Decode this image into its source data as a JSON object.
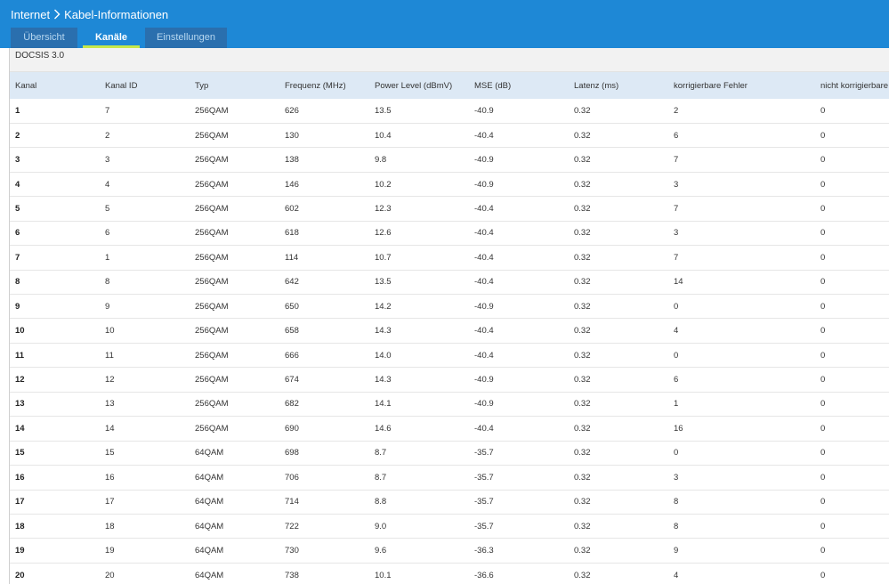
{
  "breadcrumb": {
    "parent": "Internet",
    "current": "Kabel-Informationen"
  },
  "tabs": [
    {
      "label": "Übersicht",
      "active": false
    },
    {
      "label": "Kanäle",
      "active": true
    },
    {
      "label": "Einstellungen",
      "active": false
    }
  ],
  "colors": {
    "header": "#1e88d6",
    "tab_inactive": "#2a6fae",
    "tab_active_underline": "#c6e84a",
    "table_header": "#dde9f5"
  },
  "section": {
    "title": "DOCSIS 3.0"
  },
  "table": {
    "columns": [
      "Kanal",
      "Kanal ID",
      "Typ",
      "Frequenz (MHz)",
      "Power Level (dBmV)",
      "MSE (dB)",
      "Latenz (ms)",
      "korrigierbare Fehler",
      "nicht korrigierbare"
    ],
    "rows": [
      [
        "1",
        "7",
        "256QAM",
        "626",
        "13.5",
        "-40.9",
        "0.32",
        "2",
        "0"
      ],
      [
        "2",
        "2",
        "256QAM",
        "130",
        "10.4",
        "-40.4",
        "0.32",
        "6",
        "0"
      ],
      [
        "3",
        "3",
        "256QAM",
        "138",
        "9.8",
        "-40.9",
        "0.32",
        "7",
        "0"
      ],
      [
        "4",
        "4",
        "256QAM",
        "146",
        "10.2",
        "-40.9",
        "0.32",
        "3",
        "0"
      ],
      [
        "5",
        "5",
        "256QAM",
        "602",
        "12.3",
        "-40.4",
        "0.32",
        "7",
        "0"
      ],
      [
        "6",
        "6",
        "256QAM",
        "618",
        "12.6",
        "-40.4",
        "0.32",
        "3",
        "0"
      ],
      [
        "7",
        "1",
        "256QAM",
        "114",
        "10.7",
        "-40.4",
        "0.32",
        "7",
        "0"
      ],
      [
        "8",
        "8",
        "256QAM",
        "642",
        "13.5",
        "-40.4",
        "0.32",
        "14",
        "0"
      ],
      [
        "9",
        "9",
        "256QAM",
        "650",
        "14.2",
        "-40.9",
        "0.32",
        "0",
        "0"
      ],
      [
        "10",
        "10",
        "256QAM",
        "658",
        "14.3",
        "-40.4",
        "0.32",
        "4",
        "0"
      ],
      [
        "11",
        "11",
        "256QAM",
        "666",
        "14.0",
        "-40.4",
        "0.32",
        "0",
        "0"
      ],
      [
        "12",
        "12",
        "256QAM",
        "674",
        "14.3",
        "-40.9",
        "0.32",
        "6",
        "0"
      ],
      [
        "13",
        "13",
        "256QAM",
        "682",
        "14.1",
        "-40.9",
        "0.32",
        "1",
        "0"
      ],
      [
        "14",
        "14",
        "256QAM",
        "690",
        "14.6",
        "-40.4",
        "0.32",
        "16",
        "0"
      ],
      [
        "15",
        "15",
        "64QAM",
        "698",
        "8.7",
        "-35.7",
        "0.32",
        "0",
        "0"
      ],
      [
        "16",
        "16",
        "64QAM",
        "706",
        "8.7",
        "-35.7",
        "0.32",
        "3",
        "0"
      ],
      [
        "17",
        "17",
        "64QAM",
        "714",
        "8.8",
        "-35.7",
        "0.32",
        "8",
        "0"
      ],
      [
        "18",
        "18",
        "64QAM",
        "722",
        "9.0",
        "-35.7",
        "0.32",
        "8",
        "0"
      ],
      [
        "19",
        "19",
        "64QAM",
        "730",
        "9.6",
        "-36.3",
        "0.32",
        "9",
        "0"
      ],
      [
        "20",
        "20",
        "64QAM",
        "738",
        "10.1",
        "-36.6",
        "0.32",
        "4",
        "0"
      ]
    ]
  }
}
